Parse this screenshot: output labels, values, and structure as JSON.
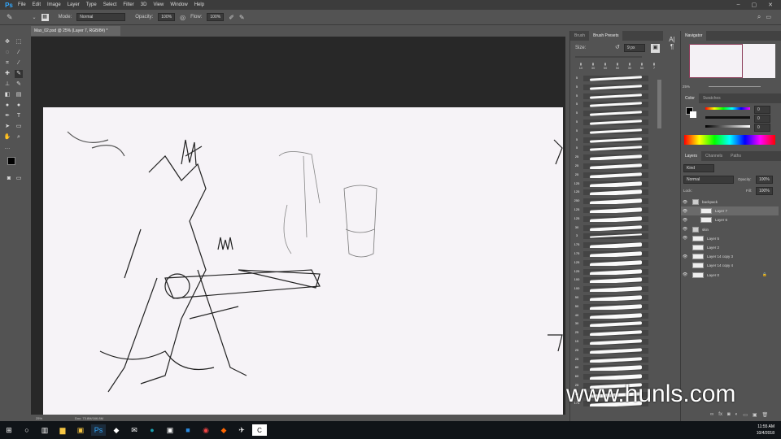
{
  "app": {
    "logo": "Ps",
    "menu": [
      "File",
      "Edit",
      "Image",
      "Layer",
      "Type",
      "Select",
      "Filter",
      "3D",
      "View",
      "Window",
      "Help"
    ]
  },
  "options": {
    "mode_label": "Mode:",
    "mode_value": "Normal",
    "opacity_label": "Opacity:",
    "opacity_value": "100%",
    "flow_label": "Flow:",
    "flow_value": "100%"
  },
  "document": {
    "tab_title": "Max_02.psd @ 25% (Layer 7, RGB/8#) *",
    "zoom": "25%",
    "doc_info": "Doc: 73.8M/166.8M"
  },
  "brush_panel": {
    "tabs": [
      "Brush",
      "Brush Presets"
    ],
    "size_label": "Size:",
    "size_value": "9 px",
    "tip_sizes": [
      "10",
      "30",
      "50",
      "50",
      "30",
      "50",
      "7"
    ],
    "preset_sizes": [
      "5",
      "5",
      "5",
      "5",
      "5",
      "5",
      "5",
      "5",
      "5",
      "25",
      "25",
      "25",
      "125",
      "125",
      "250",
      "125",
      "125",
      "30",
      "3",
      "175",
      "175",
      "125",
      "125",
      "100",
      "100",
      "50",
      "50",
      "40",
      "30",
      "25",
      "15",
      "25",
      "25",
      "80",
      "60",
      "25",
      "25",
      "175"
    ]
  },
  "navigator": {
    "title": "Navigator",
    "zoom": "25%"
  },
  "color_panel": {
    "tabs": [
      "Color",
      "Swatches"
    ],
    "r": "0",
    "g": "0",
    "b": "0",
    "accent": "#8c3d5a"
  },
  "layers_panel": {
    "tabs": [
      "Layers",
      "Channels",
      "Paths"
    ],
    "filter": "Kind",
    "blend": "Normal",
    "opacity_label": "Opacity:",
    "opacity": "100%",
    "lock_label": "Lock:",
    "fill_label": "Fill:",
    "fill": "100%",
    "layers": [
      {
        "name": "backpack",
        "visible": true,
        "group": true
      },
      {
        "name": "Layer 7",
        "visible": true,
        "selected": true
      },
      {
        "name": "Layer 6",
        "visible": true
      },
      {
        "name": "skin",
        "visible": true,
        "group": true
      },
      {
        "name": "Layer 5",
        "visible": true
      },
      {
        "name": "Layer 2",
        "visible": false
      },
      {
        "name": "Layer 14 copy 3",
        "visible": true
      },
      {
        "name": "Layer 14 copy 4",
        "visible": false
      },
      {
        "name": "Layer 0",
        "visible": true,
        "locked": true
      }
    ]
  },
  "taskbar": {
    "time": "11:55 AM",
    "date": "10/4/2018"
  },
  "watermark": "www.hunls.com"
}
